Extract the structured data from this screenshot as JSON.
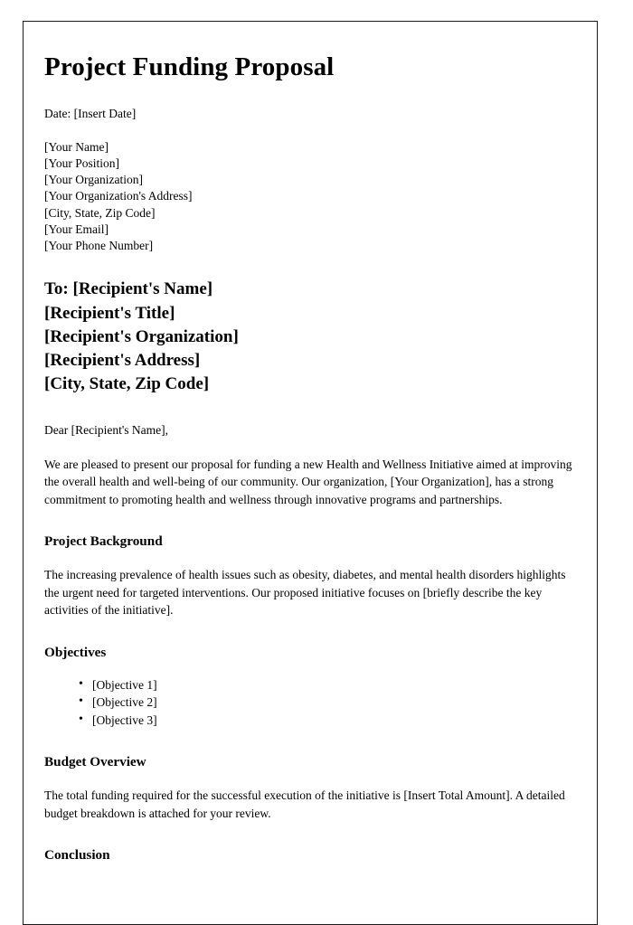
{
  "document": {
    "title": "Project Funding Proposal",
    "date_line": "Date: [Insert Date]",
    "sender": [
      "[Your Name]",
      "[Your Position]",
      "[Your Organization]",
      "[Your Organization's Address]",
      "[City, State, Zip Code]",
      "[Your Email]",
      "[Your Phone Number]"
    ],
    "recipient": [
      "To: [Recipient's Name]",
      "[Recipient's Title]",
      "[Recipient's Organization]",
      "[Recipient's Address]",
      "[City, State, Zip Code]"
    ],
    "salutation": "Dear [Recipient's Name],",
    "intro_paragraph": "We are pleased to present our proposal for funding a new Health and Wellness Initiative aimed at improving the overall health and well-being of our community. Our organization, [Your Organization], has a strong commitment to promoting health and wellness through innovative programs and partnerships.",
    "sections": {
      "background": {
        "heading": "Project Background",
        "paragraph": "The increasing prevalence of health issues such as obesity, diabetes, and mental health disorders highlights the urgent need for targeted interventions. Our proposed initiative focuses on [briefly describe the key activities of the initiative]."
      },
      "objectives": {
        "heading": "Objectives",
        "items": [
          "[Objective 1]",
          "[Objective 2]",
          "[Objective 3]"
        ]
      },
      "budget": {
        "heading": "Budget Overview",
        "paragraph": "The total funding required for the successful execution of the initiative is [Insert Total Amount]. A detailed budget breakdown is attached for your review."
      },
      "conclusion": {
        "heading": "Conclusion"
      }
    }
  }
}
